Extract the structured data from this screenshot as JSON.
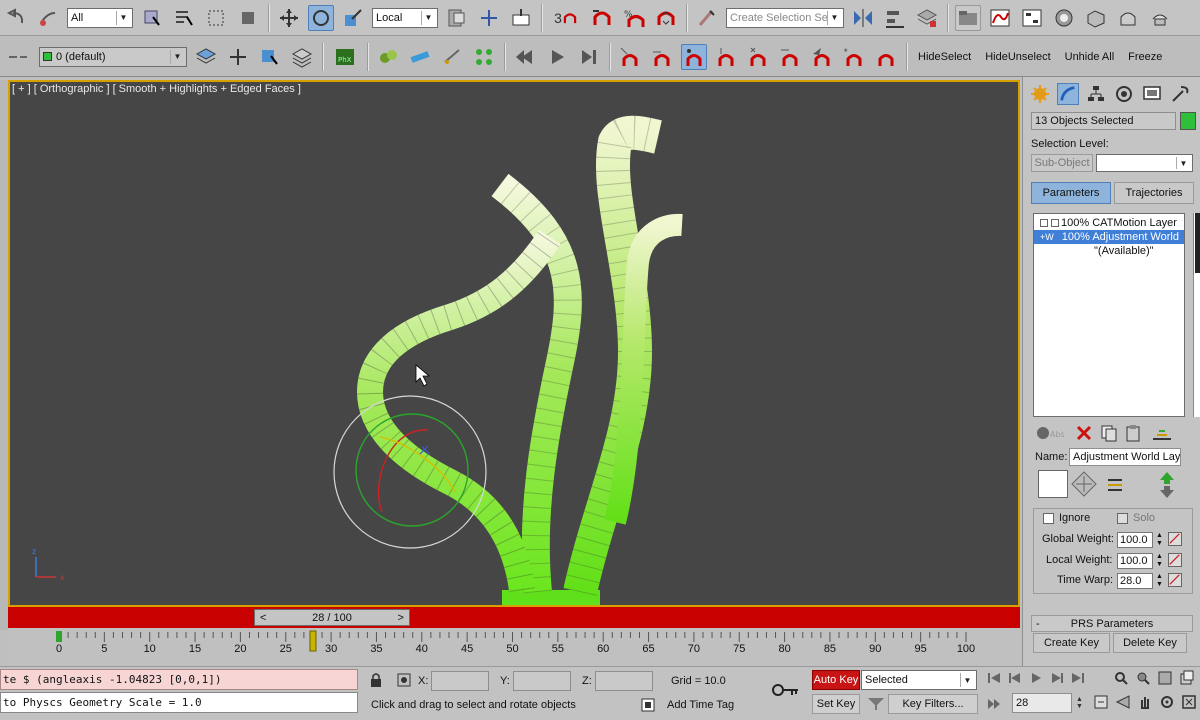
{
  "main_toolbar": {
    "selection_filter": "All",
    "ref_coord_system": "Local",
    "snap_label": "3",
    "named_selection_placeholder": "Create Selection Se"
  },
  "second_toolbar": {
    "layer": "0 (default)",
    "hide_select": "HideSelect",
    "hide_unselect": "HideUnselect",
    "unhide_all": "Unhide All",
    "freeze": "Freeze"
  },
  "viewport": {
    "label": "[ + ] [ Orthographic ] [ Smooth + Highlights + Edged Faces ]"
  },
  "time_slider": {
    "prev": "<",
    "position": "28 / 100",
    "next": ">"
  },
  "trackbar": {
    "ticks": [
      "0",
      "5",
      "10",
      "15",
      "20",
      "25",
      "30",
      "35",
      "40",
      "45",
      "50",
      "55",
      "60",
      "65",
      "70",
      "75",
      "80",
      "85",
      "90",
      "95",
      "100"
    ]
  },
  "status": {
    "maxscript_line1": "te $ (angleaxis -1.04823 [0,0,1])",
    "maxscript_line2": "to Physcs Geometry Scale = 1.0",
    "prompt": "Click and drag to select and rotate objects",
    "x_label": "X:",
    "y_label": "Y:",
    "z_label": "Z:",
    "grid": "Grid = 10.0",
    "add_time_tag": "Add Time Tag",
    "auto_key": "Auto Key",
    "set_key": "Set Key",
    "key_mode": "Selected",
    "key_filters": "Key Filters...",
    "current_frame": "28"
  },
  "command_panel": {
    "selection_name": "13 Objects Selected",
    "selection_level_label": "Selection Level:",
    "sub_object": "Sub-Object",
    "tab_parameters": "Parameters",
    "tab_trajectories": "Trajectories",
    "stack": [
      {
        "label": "100% CATMotion Layer",
        "selected": false
      },
      {
        "label": "100% Adjustment World",
        "selected": true
      },
      {
        "label": "\"(Available)\"",
        "selected": false
      }
    ],
    "name_label": "Name:",
    "name_value": "Adjustment World Lay",
    "ignore": "Ignore",
    "solo": "Solo",
    "global_weight_label": "Global Weight:",
    "global_weight": "100.0",
    "local_weight_label": "Local Weight:",
    "local_weight": "100.0",
    "time_warp_label": "Time Warp:",
    "time_warp": "28.0",
    "rollout_title": "PRS Parameters",
    "rollout_toggle": "-",
    "create_key": "Create Key",
    "delete_key": "Delete Key",
    "accent_color": "#2fbf3a"
  }
}
